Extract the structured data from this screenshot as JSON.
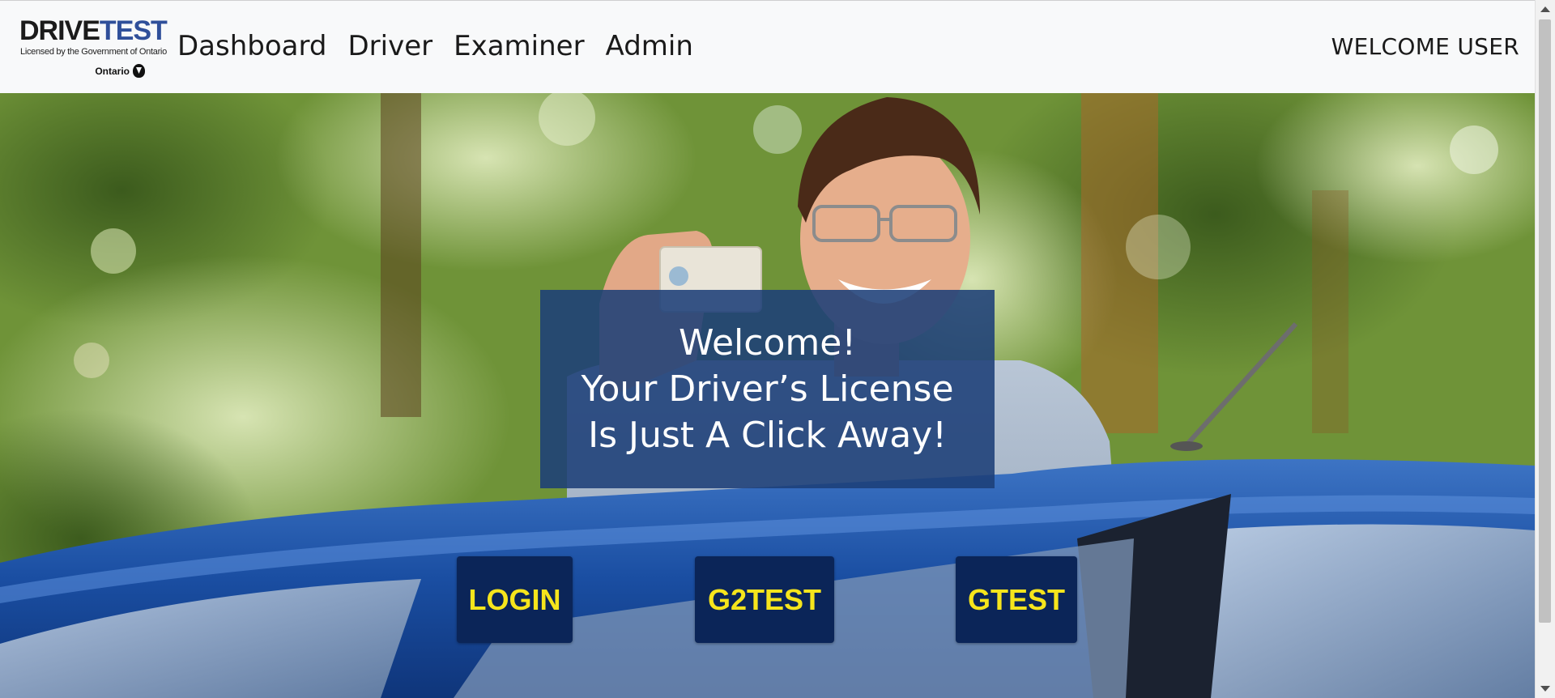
{
  "header": {
    "logo": {
      "word_drive": "DRIVE",
      "word_test": "TEST",
      "tagline": "Licensed by the Government of Ontario",
      "province": "Ontario"
    },
    "nav": [
      {
        "label": "Dashboard"
      },
      {
        "label": "Driver"
      },
      {
        "label": "Examiner"
      },
      {
        "label": "Admin"
      }
    ],
    "welcome_text": "WELCOME USER"
  },
  "hero": {
    "headline_lines": [
      "Welcome!",
      "Your Driver’s License",
      "Is Just A Click Away!"
    ],
    "buttons": [
      {
        "label": "LOGIN"
      },
      {
        "label": "G2TEST"
      },
      {
        "label": "GTEST"
      }
    ]
  },
  "colors": {
    "header_bg": "#f8f9fa",
    "welcome_box_bg": "#1c3f78",
    "button_bg": "#0b2558",
    "button_text": "#f6e51c",
    "brand_blue": "#2f4f9a"
  },
  "icons": [
    "ontario-trillium-icon"
  ]
}
